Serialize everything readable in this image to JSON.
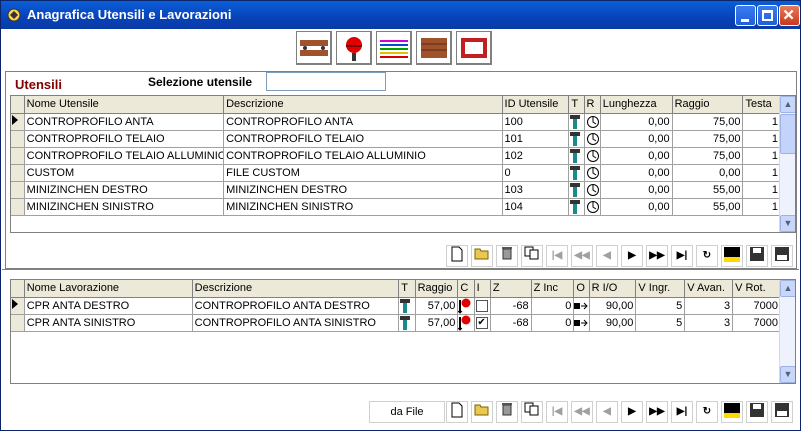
{
  "window": {
    "title": "Anagrafica Utensili e Lavorazioni"
  },
  "utensili": {
    "section_title": "Utensili",
    "selection_label": "Selezione utensile",
    "selection_value": "",
    "columns": [
      "Nome Utensile",
      "Descrizione",
      "ID Utensile",
      "T",
      "R",
      "Lunghezza",
      "Raggio",
      "Testa"
    ],
    "rows": [
      {
        "nome": "CONTROPROFILO ANTA",
        "descrizione": "CONTROPROFILO ANTA",
        "id": "100",
        "lunghezza": "0,00",
        "raggio": "75,00",
        "testa": "1"
      },
      {
        "nome": "CONTROPROFILO TELAIO",
        "descrizione": "CONTROPROFILO TELAIO",
        "id": "101",
        "lunghezza": "0,00",
        "raggio": "75,00",
        "testa": "1"
      },
      {
        "nome": "CONTROPROFILO TELAIO ALLUMINIO",
        "descrizione": "CONTROPROFILO TELAIO ALLUMINIO",
        "id": "102",
        "lunghezza": "0,00",
        "raggio": "75,00",
        "testa": "1"
      },
      {
        "nome": "CUSTOM",
        "descrizione": "FILE CUSTOM",
        "id": "0",
        "lunghezza": "0,00",
        "raggio": "0,00",
        "testa": "1"
      },
      {
        "nome": "MINIZINCHEN DESTRO",
        "descrizione": "MINIZINCHEN DESTRO",
        "id": "103",
        "lunghezza": "0,00",
        "raggio": "55,00",
        "testa": "1"
      },
      {
        "nome": "MINIZINCHEN SINISTRO",
        "descrizione": "MINIZINCHEN SINISTRO",
        "id": "104",
        "lunghezza": "0,00",
        "raggio": "55,00",
        "testa": "1"
      }
    ]
  },
  "lavorazioni": {
    "columns": [
      "Nome Lavorazione",
      "Descrizione",
      "T",
      "Raggio",
      "C",
      "I",
      "Z",
      "Z Inc",
      "O",
      "R I/O",
      "V Ingr.",
      "V Avan.",
      "V Rot."
    ],
    "rows": [
      {
        "nome": "CPR ANTA DESTRO",
        "descrizione": "CONTROPROFILO ANTA DESTRO",
        "raggio": "57,00",
        "i_checked": false,
        "z": "-68",
        "zinc": "0",
        "rio": "90,00",
        "vingr": "5",
        "vavan": "3",
        "vrot": "7000"
      },
      {
        "nome": "CPR ANTA SINISTRO",
        "descrizione": "CONTROPROFILO ANTA SINISTRO",
        "raggio": "57,00",
        "i_checked": true,
        "z": "-68",
        "zinc": "0",
        "rio": "90,00",
        "vingr": "5",
        "vavan": "3",
        "vrot": "7000"
      }
    ],
    "da_file_label": "da File"
  },
  "colors": {
    "title_bar": "#0a4fd0",
    "section_title": "#800000",
    "header_bg": "#ece9d8"
  },
  "icons": [
    "new-icon",
    "open-icon",
    "delete-icon",
    "copy-icon",
    "first-icon",
    "prev-page-icon",
    "prev-icon",
    "next-icon",
    "next-page-icon",
    "last-icon",
    "refresh-icon",
    "filter-icon",
    "save-icon",
    "export-icon"
  ]
}
